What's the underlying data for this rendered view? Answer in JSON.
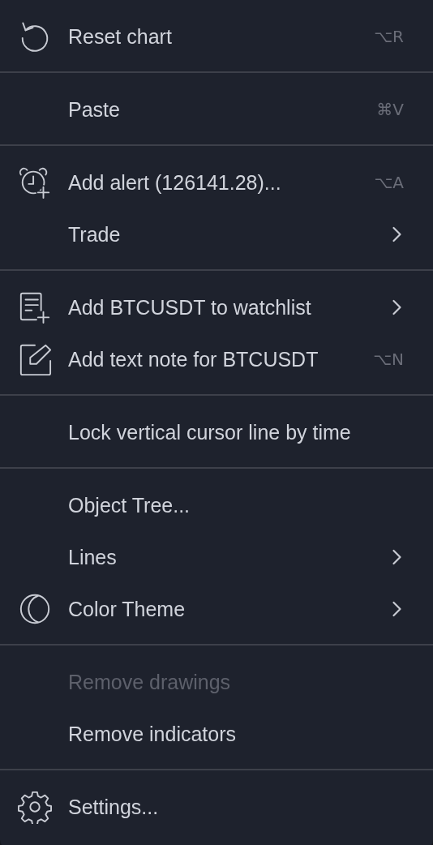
{
  "menu": {
    "groups": [
      {
        "items": [
          {
            "label": "Reset chart",
            "kind": "reset",
            "shortcut": "⌥R",
            "submenu": false,
            "disabled": false
          }
        ]
      },
      {
        "items": [
          {
            "label": "Paste",
            "shortcut": "⌘V",
            "submenu": false,
            "disabled": false
          }
        ]
      },
      {
        "items": [
          {
            "label": "Add alert (126141.28)...",
            "kind": "alarm",
            "shortcut": "⌥A",
            "submenu": false,
            "disabled": false
          },
          {
            "label": "Trade",
            "submenu": true,
            "disabled": false
          }
        ]
      },
      {
        "items": [
          {
            "label": "Add BTCUSDT to watchlist",
            "kind": "list-add",
            "submenu": true,
            "disabled": false
          },
          {
            "label": "Add text note for BTCUSDT",
            "kind": "note",
            "shortcut": "⌥N",
            "submenu": false,
            "disabled": false
          }
        ]
      },
      {
        "items": [
          {
            "label": "Lock vertical cursor line by time",
            "submenu": false,
            "disabled": false
          }
        ]
      },
      {
        "items": [
          {
            "label": "Object Tree...",
            "submenu": false,
            "disabled": false
          },
          {
            "label": "Lines",
            "submenu": true,
            "disabled": false
          },
          {
            "label": "Color Theme",
            "kind": "moon",
            "submenu": true,
            "disabled": false
          }
        ]
      },
      {
        "items": [
          {
            "label": "Remove drawings",
            "submenu": false,
            "disabled": true
          },
          {
            "label": "Remove indicators",
            "submenu": false,
            "disabled": false
          }
        ]
      },
      {
        "items": [
          {
            "label": "Settings...",
            "kind": "gear",
            "submenu": false,
            "disabled": false
          }
        ]
      }
    ]
  }
}
